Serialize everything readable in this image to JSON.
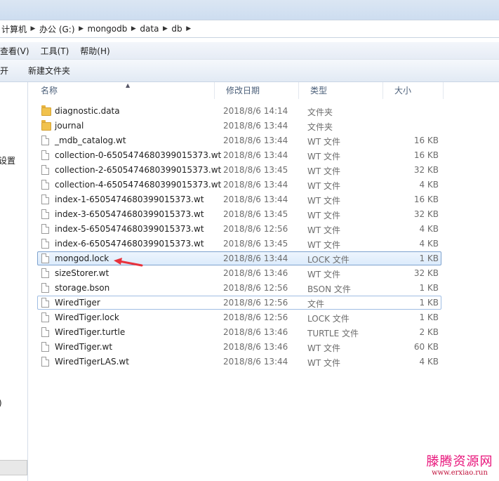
{
  "address": {
    "crumbs": [
      "计算机",
      "办公 (G:)",
      "mongodb",
      "data",
      "db"
    ]
  },
  "menu": {
    "items": [
      "查看(V)",
      "工具(T)",
      "帮助(H)"
    ]
  },
  "toolbar": {
    "open_label": "开",
    "new_folder_label": "新建文件夹"
  },
  "nav": {
    "item_settings": "设置",
    "item_paren": ")"
  },
  "columns": {
    "name": "名称",
    "date": "修改日期",
    "type": "类型",
    "size": "大小"
  },
  "files": [
    {
      "name": "diagnostic.data",
      "date": "2018/8/6 14:14",
      "type": "文件夹",
      "size": "",
      "icon": "folder-icon"
    },
    {
      "name": "journal",
      "date": "2018/8/6 13:44",
      "type": "文件夹",
      "size": "",
      "icon": "folder-icon"
    },
    {
      "name": "_mdb_catalog.wt",
      "date": "2018/8/6 13:44",
      "type": "WT 文件",
      "size": "16 KB",
      "icon": "file-icon"
    },
    {
      "name": "collection-0-6505474680399015373.wt",
      "date": "2018/8/6 13:44",
      "type": "WT 文件",
      "size": "16 KB",
      "icon": "file-icon"
    },
    {
      "name": "collection-2-6505474680399015373.wt",
      "date": "2018/8/6 13:45",
      "type": "WT 文件",
      "size": "32 KB",
      "icon": "file-icon"
    },
    {
      "name": "collection-4-6505474680399015373.wt",
      "date": "2018/8/6 13:44",
      "type": "WT 文件",
      "size": "4 KB",
      "icon": "file-icon"
    },
    {
      "name": "index-1-6505474680399015373.wt",
      "date": "2018/8/6 13:44",
      "type": "WT 文件",
      "size": "16 KB",
      "icon": "file-icon"
    },
    {
      "name": "index-3-6505474680399015373.wt",
      "date": "2018/8/6 13:45",
      "type": "WT 文件",
      "size": "32 KB",
      "icon": "file-icon"
    },
    {
      "name": "index-5-6505474680399015373.wt",
      "date": "2018/8/6 12:56",
      "type": "WT 文件",
      "size": "4 KB",
      "icon": "file-icon"
    },
    {
      "name": "index-6-6505474680399015373.wt",
      "date": "2018/8/6 13:45",
      "type": "WT 文件",
      "size": "4 KB",
      "icon": "file-icon"
    },
    {
      "name": "mongod.lock",
      "date": "2018/8/6 13:44",
      "type": "LOCK 文件",
      "size": "1 KB",
      "icon": "file-icon",
      "state": "selected"
    },
    {
      "name": "sizeStorer.wt",
      "date": "2018/8/6 13:46",
      "type": "WT 文件",
      "size": "32 KB",
      "icon": "file-icon"
    },
    {
      "name": "storage.bson",
      "date": "2018/8/6 12:56",
      "type": "BSON 文件",
      "size": "1 KB",
      "icon": "file-icon"
    },
    {
      "name": "WiredTiger",
      "date": "2018/8/6 12:56",
      "type": "文件",
      "size": "1 KB",
      "icon": "file-icon",
      "state": "focused"
    },
    {
      "name": "WiredTiger.lock",
      "date": "2018/8/6 12:56",
      "type": "LOCK 文件",
      "size": "1 KB",
      "icon": "file-icon"
    },
    {
      "name": "WiredTiger.turtle",
      "date": "2018/8/6 13:46",
      "type": "TURTLE 文件",
      "size": "2 KB",
      "icon": "file-icon"
    },
    {
      "name": "WiredTiger.wt",
      "date": "2018/8/6 13:46",
      "type": "WT 文件",
      "size": "60 KB",
      "icon": "file-icon"
    },
    {
      "name": "WiredTigerLAS.wt",
      "date": "2018/8/6 13:44",
      "type": "WT 文件",
      "size": "4 KB",
      "icon": "file-icon"
    }
  ],
  "annotation": {
    "arrow_color": "#e8323c"
  },
  "watermark": {
    "title": "滕腾资源网",
    "url": "www.erxiao.run"
  }
}
